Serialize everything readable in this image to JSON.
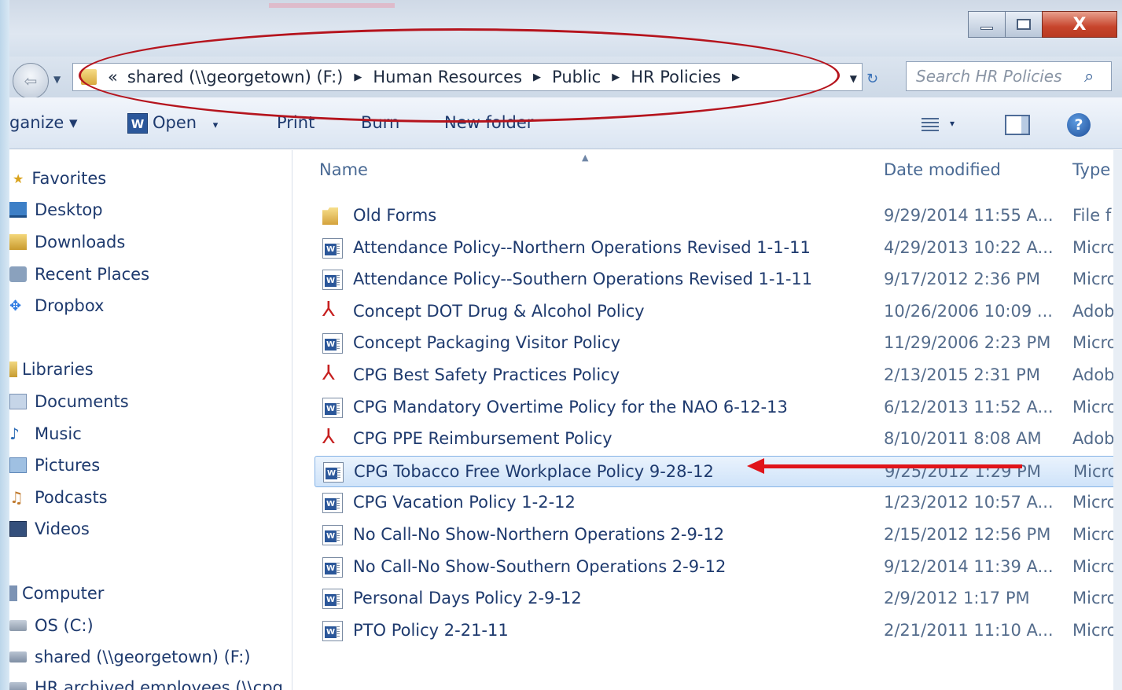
{
  "window": {
    "close_glyph": "X"
  },
  "address": {
    "overflow_glyph": "«",
    "crumbs": [
      "shared (\\\\georgetown) (F:)",
      "Human Resources",
      "Public",
      "HR Policies"
    ],
    "separator": "▶",
    "search_placeholder": "Search HR Policies"
  },
  "toolbar": {
    "organize": "ganize ▾",
    "open": "Open",
    "open_caret": "▾",
    "print": "Print",
    "burn": "Burn",
    "new_folder": "New folder",
    "views_caret": "▾",
    "help": "?"
  },
  "nav": {
    "favorites": "Favorites",
    "desktop": "Desktop",
    "downloads": "Downloads",
    "recent_places": "Recent Places",
    "dropbox": "Dropbox",
    "libraries": "Libraries",
    "documents": "Documents",
    "music": "Music",
    "pictures": "Pictures",
    "podcasts": "Podcasts",
    "videos": "Videos",
    "computer": "Computer",
    "os_c": "OS (C:)",
    "shared_f": "shared (\\\\georgetown) (F:)",
    "hr_archived": "HR archived employees (\\\\cpg"
  },
  "columns": {
    "name": "Name",
    "date_modified": "Date modified",
    "type": "Type"
  },
  "files": [
    {
      "name": "Old Forms",
      "date": "9/29/2014 11:55 A...",
      "type": "File f",
      "icon": "folder-icon"
    },
    {
      "name": "Attendance Policy--Northern Operations Revised 1-1-11",
      "date": "4/29/2013 10:22 A...",
      "type": "Micro",
      "icon": "word-doc-icon"
    },
    {
      "name": "Attendance Policy--Southern Operations Revised 1-1-11",
      "date": "9/17/2012 2:36 PM",
      "type": "Micro",
      "icon": "word-doc-icon"
    },
    {
      "name": "Concept DOT Drug & Alcohol Policy",
      "date": "10/26/2006 10:09 ...",
      "type": "Adob",
      "icon": "pdf-icon"
    },
    {
      "name": "Concept Packaging Visitor Policy",
      "date": "11/29/2006 2:23 PM",
      "type": "Micro",
      "icon": "word-doc-icon"
    },
    {
      "name": "CPG Best Safety Practices Policy",
      "date": "2/13/2015 2:31 PM",
      "type": "Adob",
      "icon": "pdf-icon"
    },
    {
      "name": "CPG Mandatory Overtime Policy for the NAO 6-12-13",
      "date": "6/12/2013 11:52 A...",
      "type": "Micro",
      "icon": "word-doc-icon"
    },
    {
      "name": "CPG PPE Reimbursement Policy",
      "date": "8/10/2011 8:08 AM",
      "type": "Adob",
      "icon": "pdf-icon"
    },
    {
      "name": "CPG Tobacco Free Workplace Policy 9-28-12",
      "date": "9/25/2012 1:29 PM",
      "type": "Micro",
      "icon": "word-doc-icon"
    },
    {
      "name": "CPG Vacation Policy 1-2-12",
      "date": "1/23/2012 10:57 A...",
      "type": "Micro",
      "icon": "word-doc-icon"
    },
    {
      "name": "No Call-No Show-Northern Operations 2-9-12",
      "date": "2/15/2012 12:56 PM",
      "type": "Micro",
      "icon": "word-doc-icon"
    },
    {
      "name": "No Call-No Show-Southern Operations 2-9-12",
      "date": "9/12/2014 11:39 A...",
      "type": "Micro",
      "icon": "word-doc-icon"
    },
    {
      "name": "Personal Days Policy 2-9-12",
      "date": "2/9/2012 1:17 PM",
      "type": "Micro",
      "icon": "word-doc-icon"
    },
    {
      "name": "PTO Policy 2-21-11",
      "date": "2/21/2011 11:10 A...",
      "type": "Micro",
      "icon": "word-doc-icon"
    }
  ],
  "annotation_colors": {
    "oval": "#b5141d",
    "arrow": "#e0141a"
  }
}
